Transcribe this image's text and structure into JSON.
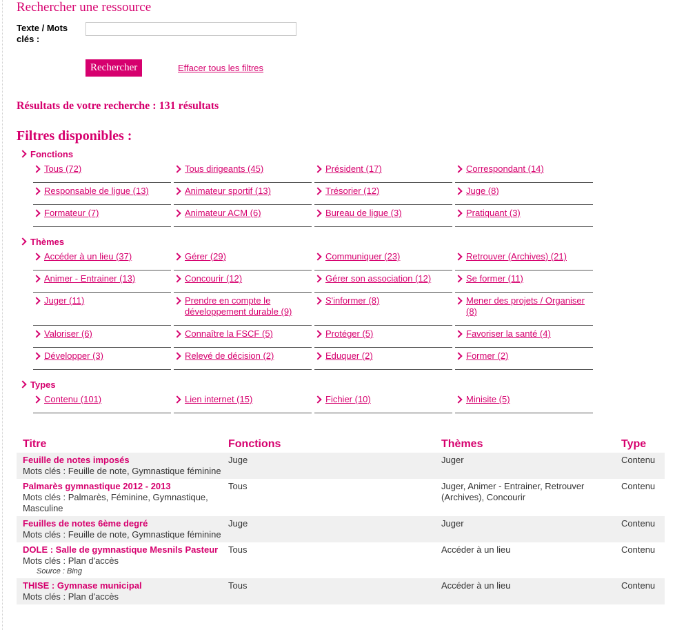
{
  "search": {
    "title": "Rechercher une ressource",
    "label": "Texte / Mots clés :",
    "input_value": "",
    "button_label": "Rechercher",
    "clear_label": "Effacer tous les filtres"
  },
  "results_summary": "Résultats de votre recherche : 131 résultats",
  "filters": {
    "heading": "Filtres disponibles :",
    "groups": [
      {
        "title": "Fonctions",
        "items": [
          "Tous (72)",
          "Tous dirigeants (45)",
          "Président (17)",
          "Correspondant (14)",
          "Responsable de ligue (13)",
          "Animateur sportif (13)",
          "Trésorier (12)",
          "Juge (8)",
          "Formateur (7)",
          "Animateur ACM (6)",
          "Bureau de ligue (3)",
          "Pratiquant (3)"
        ]
      },
      {
        "title": "Thèmes",
        "items": [
          "Accéder à un lieu (37)",
          "Gérer (29)",
          "Communiquer (23)",
          "Retrouver (Archives) (21)",
          "Animer - Entrainer (13)",
          "Concourir (12)",
          "Gérer son association (12)",
          "Se former (11)",
          "Juger (11)",
          "Prendre en compte le développement durable (9)",
          "S'informer (8)",
          "Mener des projets / Organiser (8)",
          "Valoriser (6)",
          "Connaître la FSCF (5)",
          "Protéger (5)",
          "Favoriser la santé (4)",
          "Développer (3)",
          "Relevé de décision (2)",
          "Eduquer (2)",
          "Former (2)"
        ]
      },
      {
        "title": "Types",
        "items": [
          "Contenu (101)",
          "Lien internet (15)",
          "Fichier (10)",
          "Minisite (5)"
        ]
      }
    ]
  },
  "table": {
    "headers": [
      "Titre",
      "Fonctions",
      "Thèmes",
      "Type"
    ],
    "rows": [
      {
        "title": "Feuille de notes imposés",
        "keywords": "Mots clés : Feuille de note, Gymnastique féminine",
        "source": "",
        "fonctions": "Juge",
        "themes": "Juger",
        "type": "Contenu"
      },
      {
        "title": "Palmarès gymnastique 2012 - 2013",
        "keywords": "Mots clés : Palmarès, Féminine, Gymnastique, Masculine",
        "source": "",
        "fonctions": "Tous",
        "themes": "Juger, Animer - Entrainer, Retrouver (Archives), Concourir",
        "type": "Contenu"
      },
      {
        "title": "Feuilles de notes 6ème degré",
        "keywords": "Mots clés : Feuille de note, Gymnastique féminine",
        "source": "",
        "fonctions": "Juge",
        "themes": "Juger",
        "type": "Contenu"
      },
      {
        "title": "DOLE : Salle de gymnastique Mesnils Pasteur",
        "keywords": "Mots clés : Plan d'accès",
        "source": "Source : Bing",
        "fonctions": "Tous",
        "themes": "Accéder à un lieu",
        "type": "Contenu"
      },
      {
        "title": "THISE : Gymnase municipal",
        "keywords": "Mots clés : Plan d'accès",
        "source": "",
        "fonctions": "Tous",
        "themes": "Accéder à un lieu",
        "type": "Contenu"
      }
    ]
  },
  "colors": {
    "accent": "#d6006e",
    "row_alt": "#f0f0f0"
  }
}
